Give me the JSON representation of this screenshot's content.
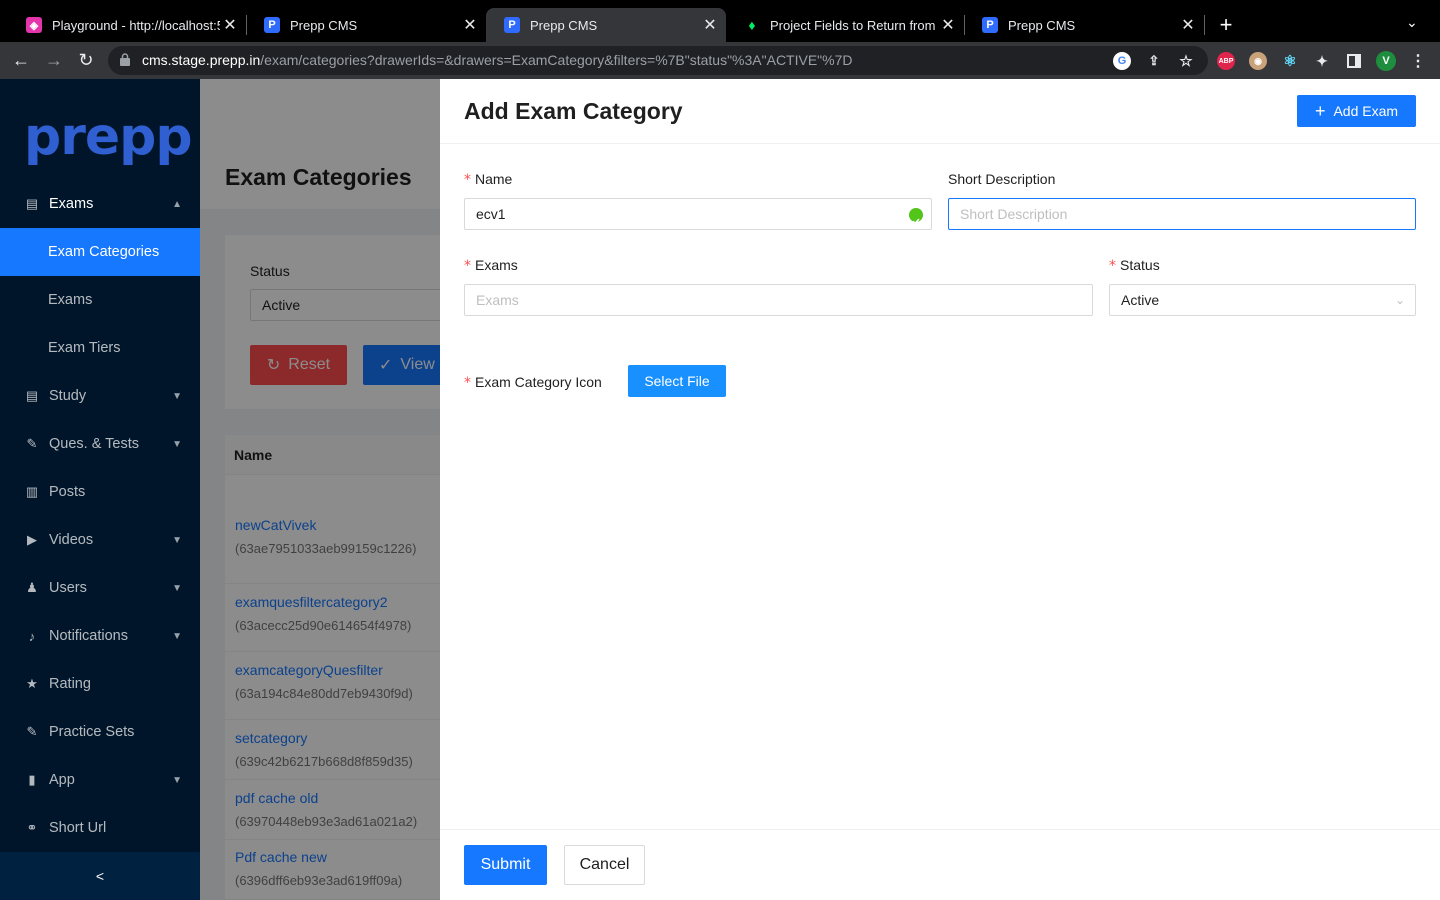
{
  "browser": {
    "tabs": [
      {
        "title": "Playground - http://localhost:5",
        "favicon": "graphql-icon",
        "favicon_color": "#e535ab"
      },
      {
        "title": "Prepp CMS",
        "favicon": "prepp-icon",
        "favicon_color": "#2f6bff"
      },
      {
        "title": "Prepp CMS",
        "favicon": "prepp-icon",
        "favicon_color": "#2f6bff",
        "active": true
      },
      {
        "title": "Project Fields to Return from Q",
        "favicon": "mongodb-leaf-icon",
        "favicon_color": "#00ed64"
      },
      {
        "title": "Prepp CMS",
        "favicon": "prepp-icon",
        "favicon_color": "#2f6bff"
      }
    ],
    "url_host": "cms.stage.prepp.in",
    "url_path": "/exam/categories?drawerIds=&drawers=ExamCategory&filters=%7B\"status\"%3A\"ACTIVE\"%7D",
    "profile_initial": "V",
    "adblock_label": "ABP"
  },
  "sidebar": {
    "logo": "prepp",
    "items": [
      {
        "label": "Exams",
        "icon": "book-icon",
        "expanded": true
      },
      {
        "label": "Exam Categories",
        "selected": true
      },
      {
        "label": "Exams"
      },
      {
        "label": "Exam Tiers"
      },
      {
        "label": "Study",
        "icon": "book-icon"
      },
      {
        "label": "Ques. & Tests",
        "icon": "edit-icon"
      },
      {
        "label": "Posts",
        "icon": "file-icon"
      },
      {
        "label": "Videos",
        "icon": "video-icon"
      },
      {
        "label": "Users",
        "icon": "team-icon"
      },
      {
        "label": "Notifications",
        "icon": "bell-icon"
      },
      {
        "label": "Rating",
        "icon": "star-icon"
      },
      {
        "label": "Practice Sets",
        "icon": "edit-icon"
      },
      {
        "label": "App",
        "icon": "mobile-icon"
      },
      {
        "label": "Short Url",
        "icon": "link-icon"
      }
    ],
    "collapse_icon": "<"
  },
  "main": {
    "page_title": "Exam Categories",
    "filter": {
      "status_label": "Status",
      "status_value": "Active",
      "reset_label": "Reset",
      "view_label": "View"
    },
    "table": {
      "header_name": "Name",
      "rows": [
        {
          "name": "newCatVivek",
          "id": "(63ae7951033aeb99159c1226)"
        },
        {
          "name": "examquesfiltercategory2",
          "id": "(63acecc25d90e614654f4978)"
        },
        {
          "name": "examcategoryQuesfilter",
          "id": "(63a194c84e80dd7eb9430f9d)"
        },
        {
          "name": "setcategory",
          "id": "(639c42b6217b668d8f859d35)"
        },
        {
          "name": "pdf cache old",
          "id": "(63970448eb93e3ad61a021a2)"
        },
        {
          "name": "Pdf cache new",
          "id": "(6396dff6eb93e3ad619ff09a)"
        }
      ]
    }
  },
  "drawer": {
    "title": "Add Exam Category",
    "add_exam_label": "Add Exam",
    "fields": {
      "name_label": "Name",
      "name_value": "ecv1",
      "short_desc_label": "Short Description",
      "short_desc_placeholder": "Short Description",
      "exams_label": "Exams",
      "exams_placeholder": "Exams",
      "status_label": "Status",
      "status_value": "Active",
      "icon_label": "Exam Category Icon",
      "select_file_label": "Select File"
    },
    "footer": {
      "submit_label": "Submit",
      "cancel_label": "Cancel"
    }
  },
  "colors": {
    "primary": "#1677ff",
    "danger": "#ff4d4f",
    "success": "#52c41a",
    "sidebar_bg": "#001529"
  }
}
